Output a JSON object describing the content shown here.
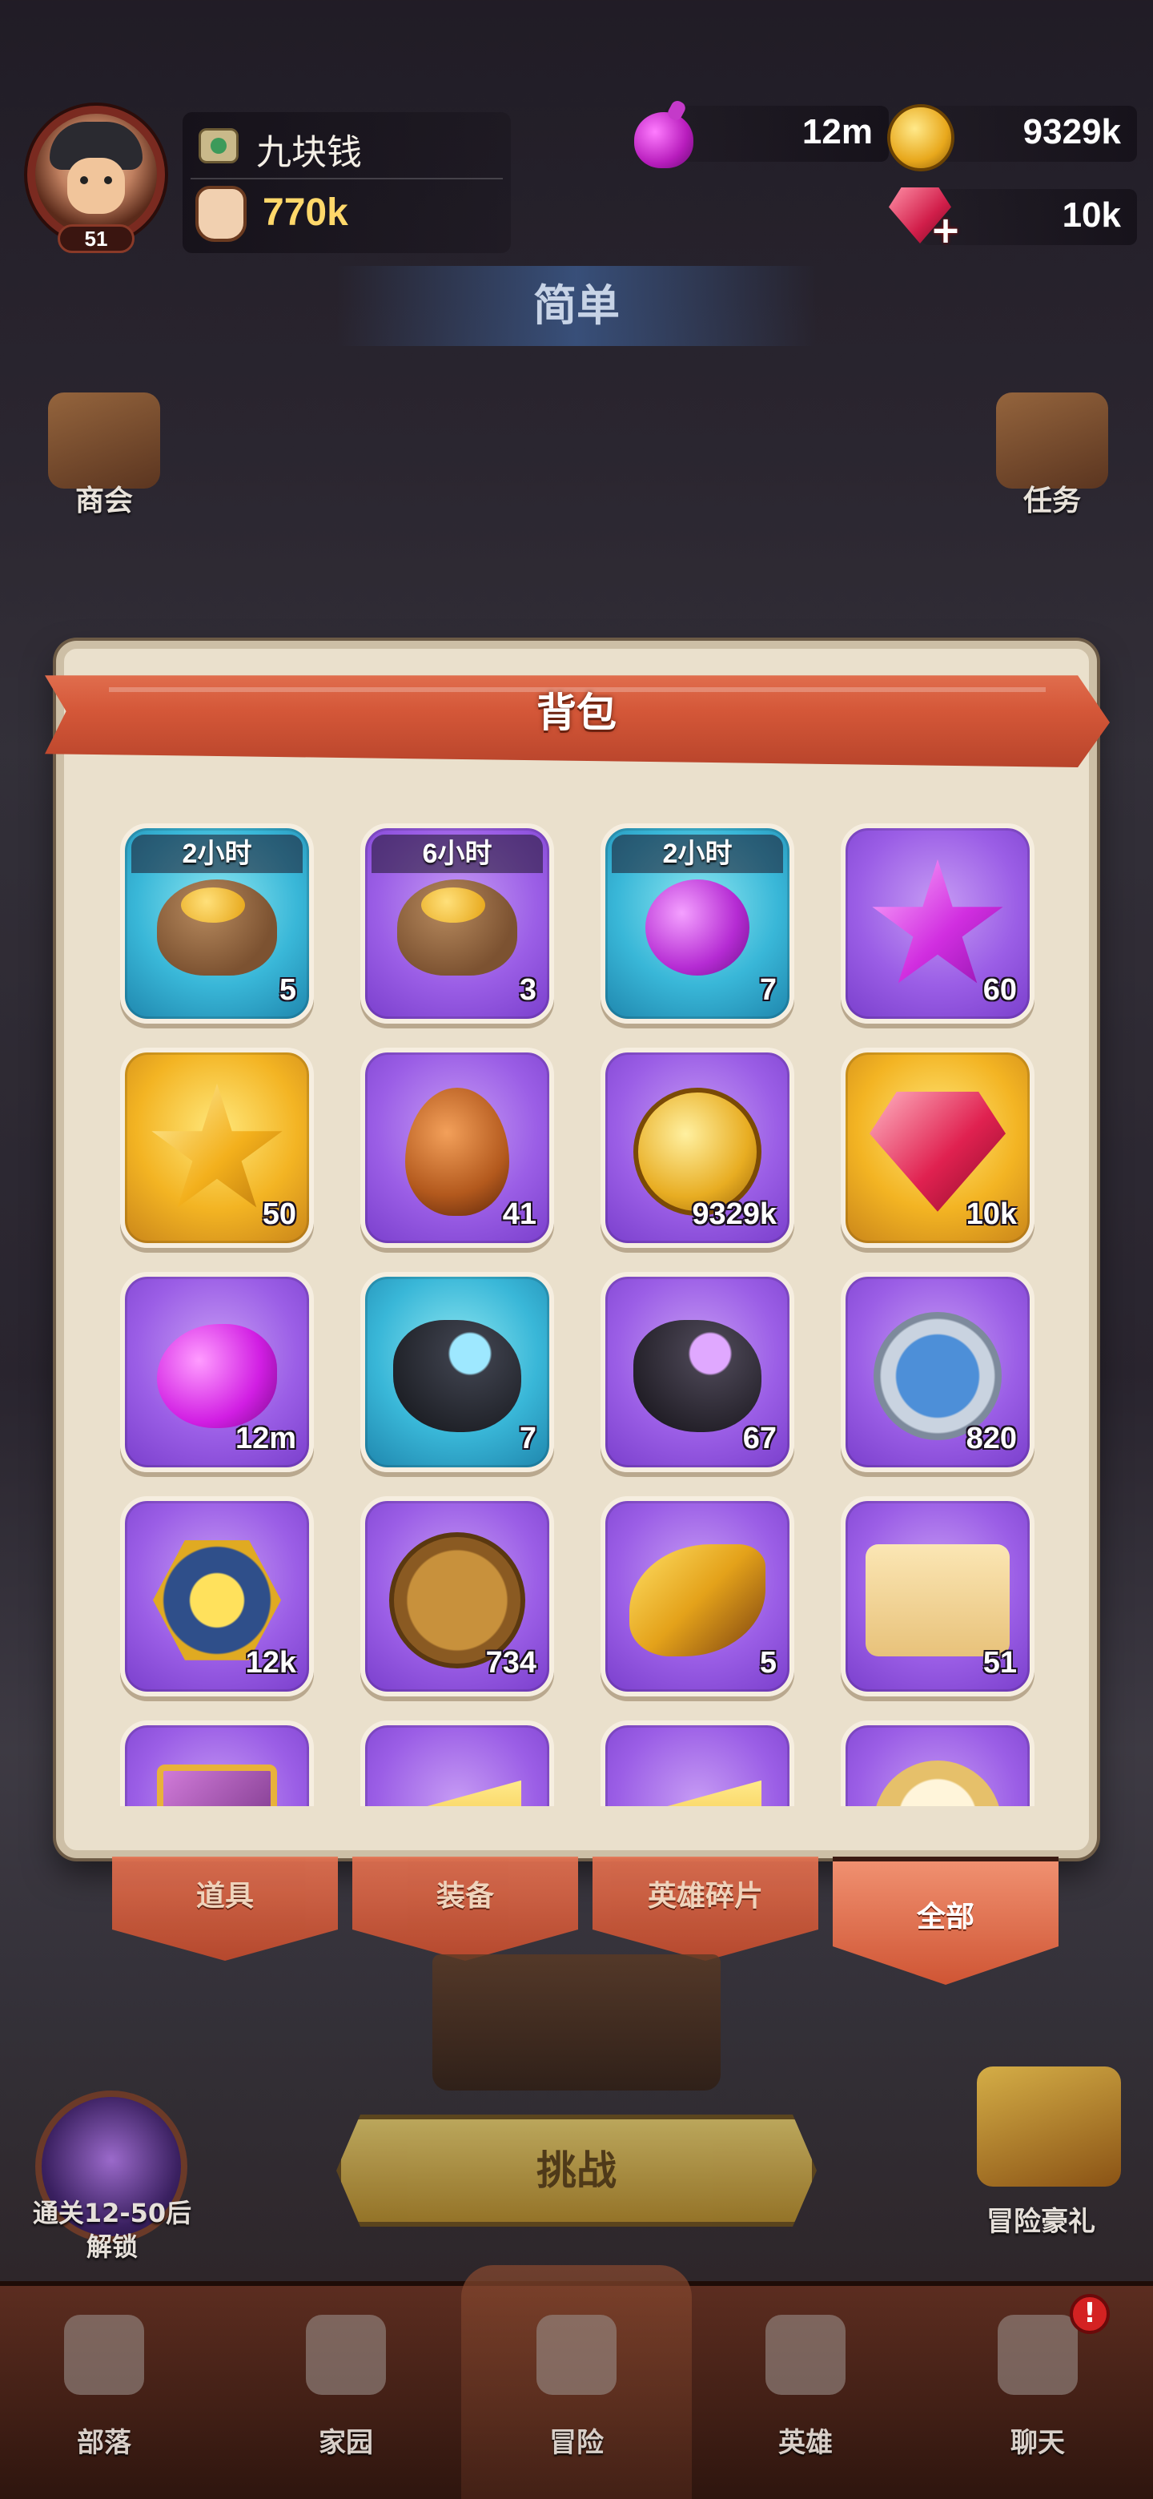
{
  "player": {
    "name": "九块钱",
    "level": "51",
    "power": "770k"
  },
  "resources": {
    "potion": "12m",
    "gold": "9329k",
    "gems": "10k"
  },
  "difficulty": "简单",
  "side_buttons": {
    "left": "商会",
    "right": "任务"
  },
  "backpack": {
    "title": "背包",
    "items": [
      {
        "icon": "gold-bag-icon",
        "timer": "2小时",
        "count": "5",
        "frame": "blue"
      },
      {
        "icon": "gold-bag-icon",
        "timer": "6小时",
        "count": "3",
        "frame": "purple"
      },
      {
        "icon": "potion-bottle-icon",
        "timer": "2小时",
        "count": "7",
        "frame": "blue"
      },
      {
        "icon": "purple-star-icon",
        "timer": "",
        "count": "60",
        "frame": "purple"
      },
      {
        "icon": "gold-star-icon",
        "timer": "",
        "count": "50",
        "frame": "gold"
      },
      {
        "icon": "dragon-egg-icon",
        "timer": "",
        "count": "41",
        "frame": "purple"
      },
      {
        "icon": "gold-coin-icon",
        "timer": "",
        "count": "9329k",
        "frame": "purple"
      },
      {
        "icon": "ruby-gem-icon",
        "timer": "",
        "count": "10k",
        "frame": "gold"
      },
      {
        "icon": "purple-blob-icon",
        "timer": "",
        "count": "12m",
        "frame": "purple"
      },
      {
        "icon": "blue-crystal-rock-icon",
        "timer": "",
        "count": "7",
        "frame": "blue"
      },
      {
        "icon": "purple-crystal-rock-icon",
        "timer": "",
        "count": "67",
        "frame": "purple"
      },
      {
        "icon": "laurel-medal-icon",
        "timer": "",
        "count": "820",
        "frame": "purple"
      },
      {
        "icon": "hammer-badge-icon",
        "timer": "",
        "count": "12k",
        "frame": "purple"
      },
      {
        "icon": "anchor-coin-icon",
        "timer": "",
        "count": "734",
        "frame": "purple"
      },
      {
        "icon": "war-horn-icon",
        "timer": "",
        "count": "5",
        "frame": "purple"
      },
      {
        "icon": "sword-scroll-icon",
        "timer": "",
        "count": "51",
        "frame": "purple"
      },
      {
        "icon": "treasure-crate-icon",
        "timer": "",
        "count": "",
        "frame": "purple"
      },
      {
        "icon": "cheese-icon",
        "timer": "",
        "count": "",
        "frame": "purple"
      },
      {
        "icon": "cheese-icon",
        "timer": "",
        "count": "",
        "frame": "purple"
      },
      {
        "icon": "silver-coin-icon",
        "timer": "",
        "count": "",
        "frame": "purple"
      }
    ]
  },
  "tabs": [
    {
      "label": "道具",
      "active": false
    },
    {
      "label": "装备",
      "active": false
    },
    {
      "label": "英雄碎片",
      "active": false
    },
    {
      "label": "全部",
      "active": true
    }
  ],
  "challenge_label": "挑战",
  "unlock_label": "通关12-50后解锁",
  "gift_label": "冒险豪礼",
  "nav": [
    {
      "label": "部落",
      "icon": "tribe-shield-icon"
    },
    {
      "label": "家园",
      "icon": "home-icon"
    },
    {
      "label": "冒险",
      "icon": "crossed-swords-icon",
      "active": true
    },
    {
      "label": "英雄",
      "icon": "viking-helmet-icon"
    },
    {
      "label": "聊天",
      "icon": "chat-bubble-icon",
      "badge": "!"
    }
  ],
  "colors": {
    "banner": "#d45738",
    "panel": "#eae0cc",
    "frame_purple": "#9b5ee6",
    "frame_blue": "#39b7d8",
    "frame_gold": "#f3b423"
  }
}
